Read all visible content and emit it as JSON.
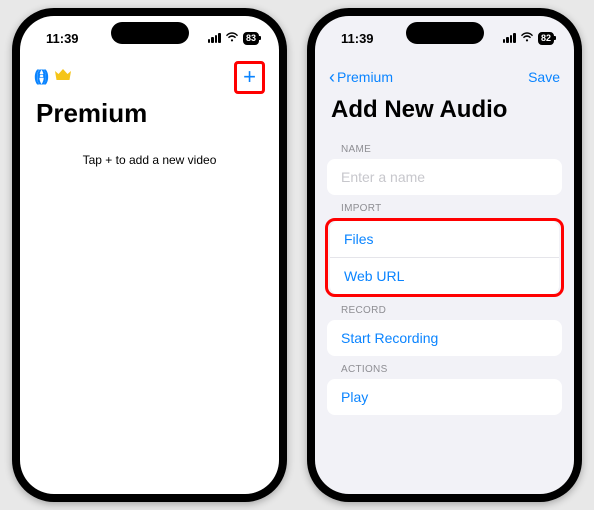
{
  "status": {
    "time": "11:39",
    "battery_left": "83",
    "battery_right": "82"
  },
  "left": {
    "title": "Premium",
    "empty_message": "Tap + to add a new video",
    "add_glyph": "+"
  },
  "right": {
    "back_label": "Premium",
    "save_label": "Save",
    "title": "Add New Audio",
    "sections": {
      "name_label": "NAME",
      "name_placeholder": "Enter a name",
      "import_label": "IMPORT",
      "import_files": "Files",
      "import_weburl": "Web URL",
      "record_label": "RECORD",
      "record_action": "Start Recording",
      "actions_label": "ACTIONS",
      "actions_play": "Play"
    }
  }
}
